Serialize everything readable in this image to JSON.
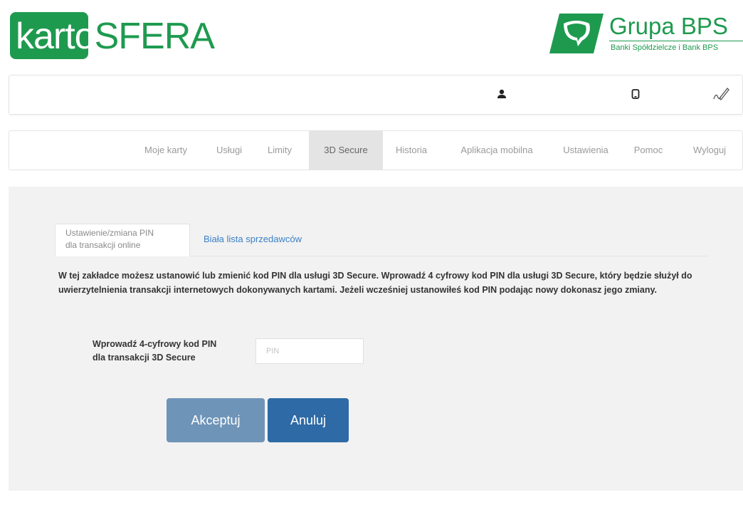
{
  "header": {
    "logo_karto_part1": "karto",
    "logo_karto_part2": "SFERA",
    "logo_bps_name": "Grupa BPS",
    "logo_bps_subtitle": "Banki Spółdzielcze i Bank BPS"
  },
  "user_bar": {
    "icons": [
      "user-icon",
      "phone-icon",
      "signature-icon"
    ]
  },
  "nav": {
    "items": [
      {
        "label": "Moje karty"
      },
      {
        "label": "Usługi"
      },
      {
        "label": "Limity"
      },
      {
        "label": "3D Secure",
        "active": true
      },
      {
        "label": "Historia"
      },
      {
        "label": "Aplikacja mobilna"
      },
      {
        "label": "Ustawienia"
      },
      {
        "label": "Pomoc"
      },
      {
        "label": "Wyloguj"
      }
    ]
  },
  "tabs": {
    "active_line1": "Ustawienie/zmiana PIN",
    "active_line2": "dla transakcji online",
    "secondary": "Biała lista sprzedawców"
  },
  "info_text": "W tej zakładce możesz ustanowić lub zmienić kod PIN dla usługi 3D Secure. Wprowadź 4 cyfrowy kod PIN dla usługi 3D Secure, który będzie służył do uwierzytelnienia transakcji internetowych dokonywanych kartami. Jeżeli wcześniej ustanowiłeś kod PIN podając nowy dokonasz jego zmiany.",
  "form": {
    "pin_label_line1": "Wprowadź 4-cyfrowy kod PIN",
    "pin_label_line2": "dla transakcji 3D Secure",
    "pin_value": "",
    "pin_placeholder": "PIN"
  },
  "buttons": {
    "accept": "Akceptuj",
    "cancel": "Anuluj"
  },
  "colors": {
    "brand_green": "#1e9a4f",
    "accept_button": "#6e94b8",
    "cancel_button": "#2e6aa5",
    "link": "#3b80c6",
    "panel_bg": "#f2f2f2"
  }
}
